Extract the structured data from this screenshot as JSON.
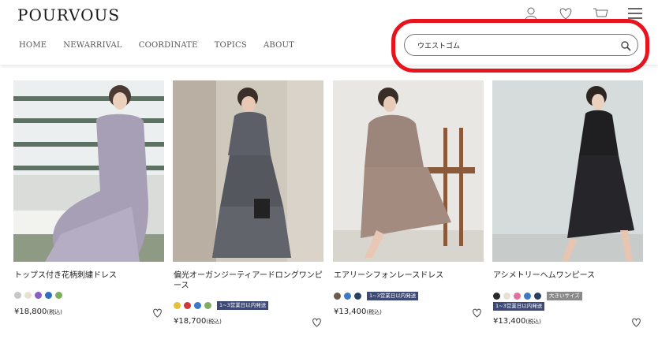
{
  "header": {
    "logo": "POURVOUS",
    "nav": [
      "HOME",
      "NEWARRIVAL",
      "COORDINATE",
      "TOPICS",
      "ABOUT"
    ],
    "icons": [
      "user-icon",
      "heart-icon",
      "cart-icon",
      "menu-icon"
    ]
  },
  "search": {
    "value": "ウエストゴム",
    "icon": "search-icon",
    "highlight_color": "#e8141d"
  },
  "products": [
    {
      "name": "トップス付き花柄刺繍ドレス",
      "swatches": [
        "#c7c7c7",
        "#e6e2d3",
        "#8a5fc1",
        "#2f6ec2",
        "#7fae62"
      ],
      "badges": [],
      "price": "¥18,800",
      "tax": "(税込)"
    },
    {
      "name": "偏光オーガンジーティアードロングワンピース",
      "swatches": [
        "#e3c13a",
        "#d0383c",
        "#3b78c8",
        "#7fae62"
      ],
      "badges": [
        "1~3営業日以内発送"
      ],
      "price": "¥18,700",
      "tax": "(税込)"
    },
    {
      "name": "エアリーシフォンレースドレス",
      "swatches": [
        "#6e5a4a",
        "#3e79c1",
        "#2b3f63"
      ],
      "badges": [
        "1~3営業日以内発送"
      ],
      "price": "¥13,400",
      "tax": "(税込)"
    },
    {
      "name": "アシメトリーヘムワンピース",
      "swatches": [
        "#2a2a2a",
        "#e6e2d3",
        "#e3709a",
        "#3e79c1",
        "#2b3f63"
      ],
      "badges": [
        "大きいサイズ",
        "1~3営業日以内発送"
      ],
      "price": "¥13,400",
      "tax": "(税込)"
    }
  ]
}
